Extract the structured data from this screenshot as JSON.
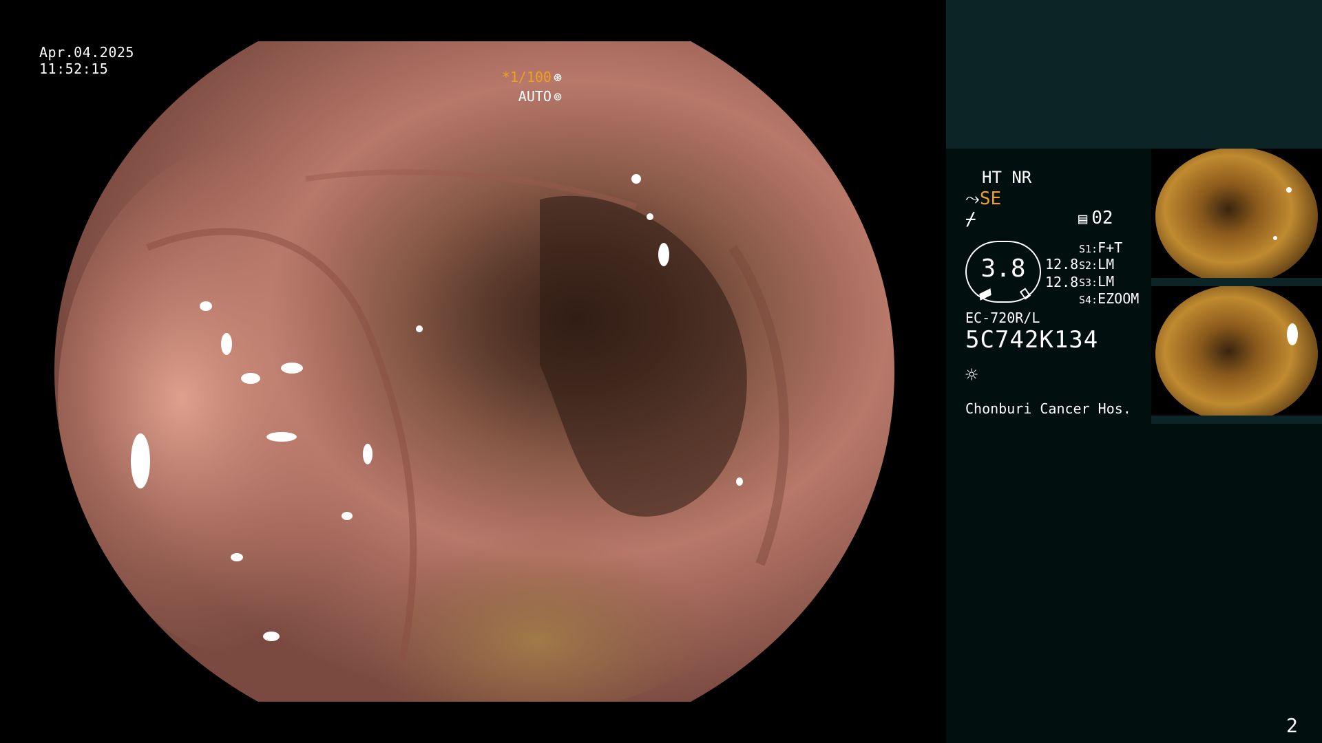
{
  "overlay": {
    "date": "Apr.04.2025",
    "time": "11:52:15",
    "shutter": "*1/100",
    "shutter_icon": "⊛",
    "iris": "AUTO",
    "iris_icon": "⊚"
  },
  "panel": {
    "ht_nr": "HT NR",
    "se_prefix": "⤳",
    "se": "SE",
    "enh_icon": "⌿",
    "rec_icon": "▤",
    "rec_number": "02",
    "gauge_value": "3.8",
    "value_1": "12.8",
    "value_2": "12.8",
    "switches": [
      {
        "key": "S1:",
        "value": "F+T"
      },
      {
        "key": "S2:",
        "value": "LM"
      },
      {
        "key": "S3:",
        "value": "LM"
      },
      {
        "key": "S4:",
        "value": "EZOOM"
      }
    ],
    "scope_model": "EC-720R/L",
    "serial": "5C742K134",
    "light_icon": "☼",
    "hospital": "Chonburi Cancer Hos.",
    "page_number": "2"
  },
  "colors": {
    "accent": "#f0a020",
    "panel_bg": "#020f0f",
    "panel_top": "#0d2426",
    "mucosa": "#c98070"
  }
}
